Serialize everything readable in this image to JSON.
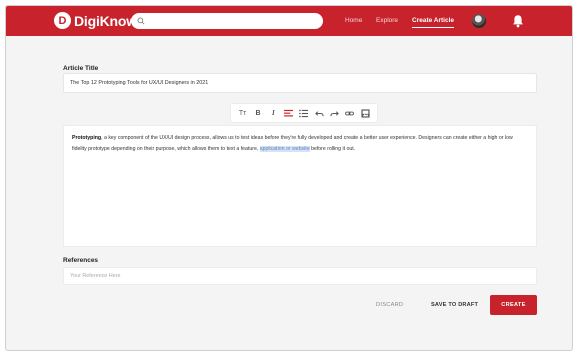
{
  "app": {
    "name": "DigiKnow",
    "logo_letter": "D"
  },
  "navbar": {
    "search_placeholder": "",
    "links": [
      {
        "label": "Home",
        "active": false
      },
      {
        "label": "Explore",
        "active": false
      },
      {
        "label": "Create Article",
        "active": true
      }
    ],
    "accent_color": "#c8232c"
  },
  "article": {
    "title_label": "Article Title",
    "title_value": "The Top 12 Prototyping Tools for UX/UI Designers in 2021"
  },
  "toolbar": {
    "items": [
      {
        "icon": "text-size-icon",
        "glyph": "Tт"
      },
      {
        "icon": "bold-icon",
        "glyph": "B"
      },
      {
        "icon": "italic-icon",
        "glyph": "I"
      },
      {
        "icon": "align-icon",
        "glyph": ""
      },
      {
        "icon": "list-icon",
        "glyph": ""
      },
      {
        "icon": "undo-icon",
        "glyph": ""
      },
      {
        "icon": "redo-icon",
        "glyph": ""
      },
      {
        "icon": "link-icon",
        "glyph": ""
      },
      {
        "icon": "image-icon",
        "glyph": ""
      }
    ]
  },
  "editor": {
    "bold_lead": "Prototyping",
    "text_part1": ", a key component of the UX/UI design process, allows us to test ideas before they're fully developed and create a better user experience. Designers can create either a high or low fidelity prototype depending on their purpose, which allows them to text a feature, ",
    "highlighted": "application or website",
    "text_part2": " before rolling it out."
  },
  "references": {
    "label": "References",
    "placeholder": "Your Reference Here"
  },
  "actions": {
    "discard": "DISCARD",
    "save_draft": "SAVE TO DRAFT",
    "create": "CREATE"
  }
}
